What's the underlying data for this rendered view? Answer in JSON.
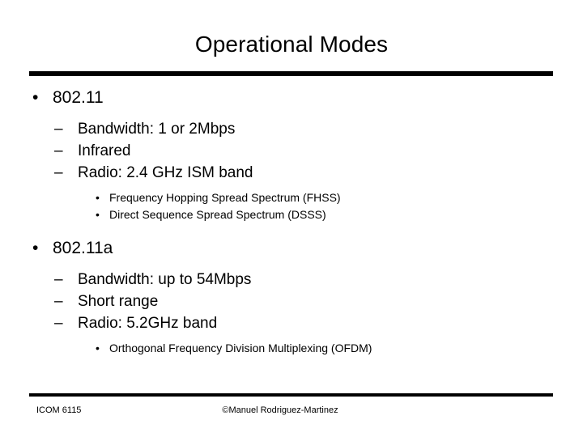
{
  "slide": {
    "title": "Operational Modes",
    "background_color": "#ffffff",
    "text_color": "#000000",
    "markers": {
      "level1": "•",
      "level2": "–",
      "level3": "•"
    },
    "content": [
      {
        "level": 1,
        "text": "802.11"
      },
      {
        "level": 2,
        "text": "Bandwidth: 1 or 2Mbps"
      },
      {
        "level": 2,
        "text": "Infrared"
      },
      {
        "level": 2,
        "text": "Radio: 2.4 GHz ISM band"
      },
      {
        "level": 3,
        "text": "Frequency Hopping Spread Spectrum (FHSS)"
      },
      {
        "level": 3,
        "text": "Direct Sequence Spread Spectrum (DSSS)"
      },
      {
        "level": 1,
        "text": "802.11a"
      },
      {
        "level": 2,
        "text": "Bandwidth: up to 54Mbps"
      },
      {
        "level": 2,
        "text": "Short range"
      },
      {
        "level": 2,
        "text": "Radio: 5.2GHz band"
      },
      {
        "level": 3,
        "text": "Orthogonal Frequency Division Multiplexing (OFDM)"
      }
    ]
  },
  "footer": {
    "course": "ICOM 6115",
    "copyright": "©Manuel Rodriguez-Martinez"
  }
}
